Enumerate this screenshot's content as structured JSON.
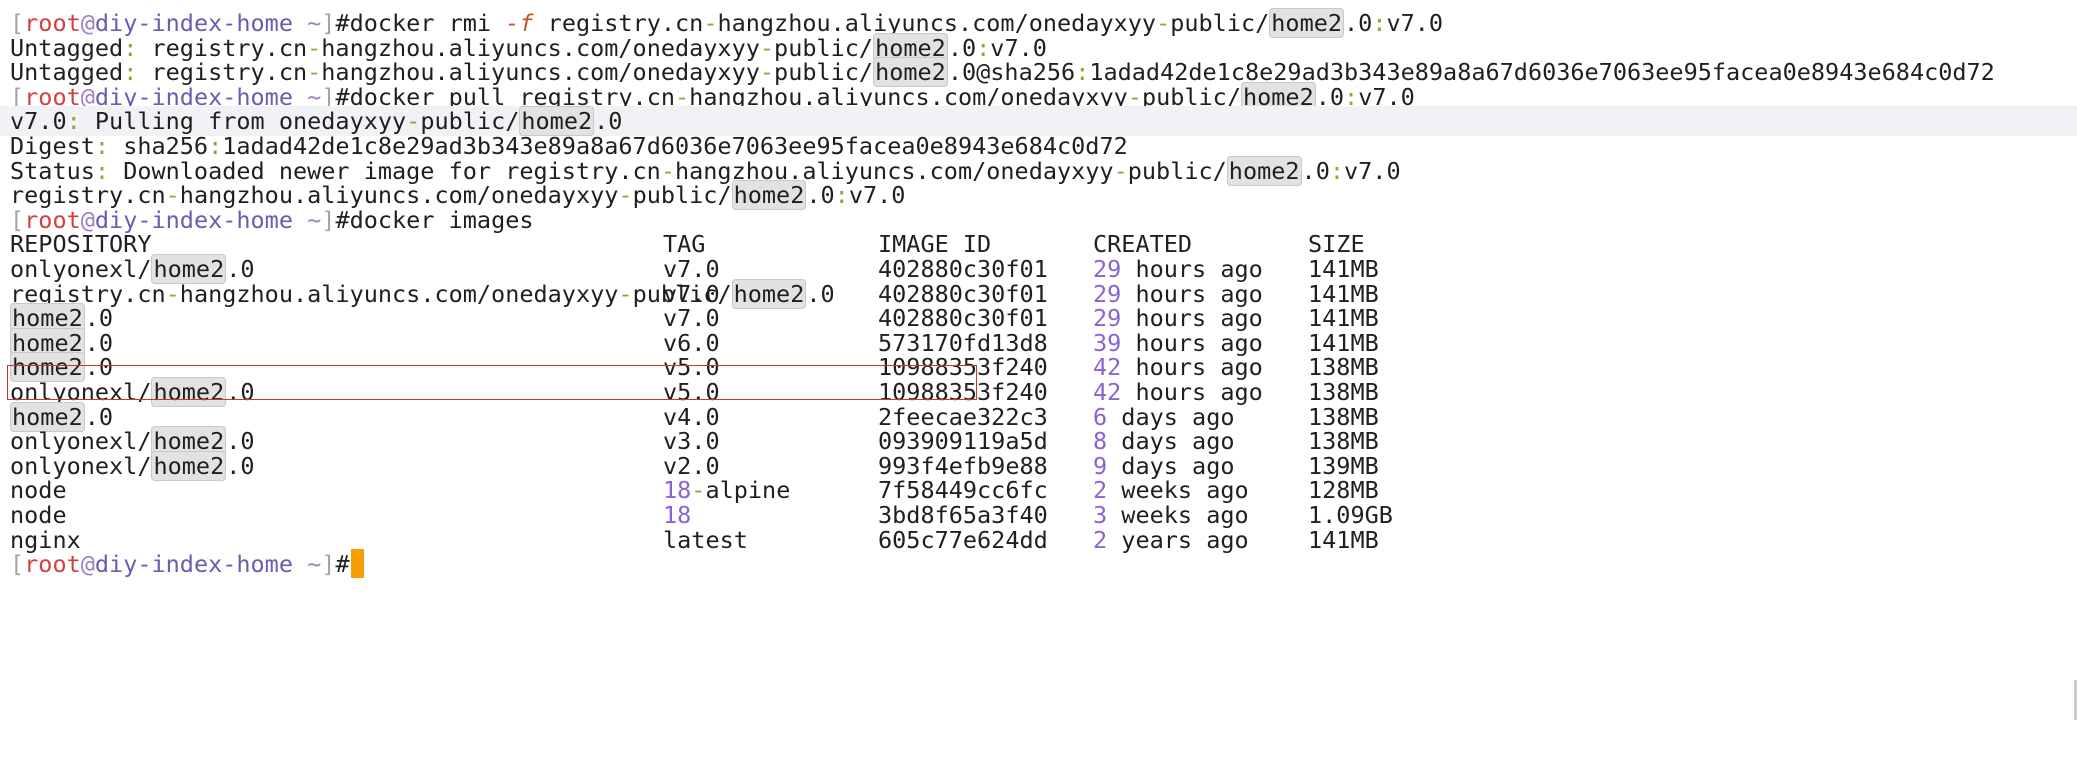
{
  "prompt": {
    "open": "[",
    "user": "root",
    "at": "@",
    "host": "diy-index-home",
    "tilde": " ~",
    "close": "]",
    "hash": "#"
  },
  "lines": [
    {
      "type": "cmd",
      "tokens": [
        {
          "t": "docker rmi "
        },
        {
          "t": "-f",
          "c": "flag"
        },
        {
          "t": " registry.cn"
        },
        {
          "t": "-",
          "c": "sep"
        },
        {
          "t": "hangzhou.aliyuncs.com/onedayxyy"
        },
        {
          "t": "-",
          "c": "sep"
        },
        {
          "t": "public/"
        },
        {
          "t": "home2",
          "c": "match"
        },
        {
          "t": ".0"
        },
        {
          "t": ":",
          "c": "sep"
        },
        {
          "t": "v7.0"
        }
      ]
    },
    {
      "type": "out",
      "tokens": [
        {
          "t": "Untagged"
        },
        {
          "t": ":",
          "c": "sep"
        },
        {
          "t": " registry.cn"
        },
        {
          "t": "-",
          "c": "sep"
        },
        {
          "t": "hangzhou.aliyuncs.com/onedayxyy"
        },
        {
          "t": "-",
          "c": "sep"
        },
        {
          "t": "public/"
        },
        {
          "t": "home2",
          "c": "match"
        },
        {
          "t": ".0"
        },
        {
          "t": ":",
          "c": "sep"
        },
        {
          "t": "v7.0"
        }
      ]
    },
    {
      "type": "out",
      "tokens": [
        {
          "t": "Untagged"
        },
        {
          "t": ":",
          "c": "sep"
        },
        {
          "t": " registry.cn"
        },
        {
          "t": "-",
          "c": "sep"
        },
        {
          "t": "hangzhou.aliyuncs.com/onedayxyy"
        },
        {
          "t": "-",
          "c": "sep"
        },
        {
          "t": "public/"
        },
        {
          "t": "home2",
          "c": "match"
        },
        {
          "t": ".0@sha256"
        },
        {
          "t": ":",
          "c": "sep"
        },
        {
          "t": "1adad42de1c8e29ad3b343e89a8a67d6036e7063ee95facea0e8943e684c0d72"
        }
      ]
    },
    {
      "type": "cmd",
      "tokens": [
        {
          "t": "docker pull registry.cn"
        },
        {
          "t": "-",
          "c": "sep"
        },
        {
          "t": "hangzhou.aliyuncs.com/onedayxyy"
        },
        {
          "t": "-",
          "c": "sep"
        },
        {
          "t": "public/"
        },
        {
          "t": "home2",
          "c": "match"
        },
        {
          "t": ".0"
        },
        {
          "t": ":",
          "c": "sep"
        },
        {
          "t": "v7.0"
        }
      ]
    },
    {
      "type": "out",
      "highlight": true,
      "tokens": [
        {
          "t": "v7.0"
        },
        {
          "t": ":",
          "c": "sep"
        },
        {
          "t": " Pulling from onedayxyy"
        },
        {
          "t": "-",
          "c": "sep"
        },
        {
          "t": "public/"
        },
        {
          "t": "home2",
          "c": "match"
        },
        {
          "t": ".0"
        }
      ]
    },
    {
      "type": "out",
      "tokens": [
        {
          "t": "Digest"
        },
        {
          "t": ":",
          "c": "sep"
        },
        {
          "t": " sha256"
        },
        {
          "t": ":",
          "c": "sep"
        },
        {
          "t": "1adad42de1c8e29ad3b343e89a8a67d6036e7063ee95facea0e8943e684c0d72"
        }
      ]
    },
    {
      "type": "out",
      "tokens": [
        {
          "t": "Status"
        },
        {
          "t": ":",
          "c": "sep"
        },
        {
          "t": " Downloaded newer image for registry.cn"
        },
        {
          "t": "-",
          "c": "sep"
        },
        {
          "t": "hangzhou.aliyuncs.com/onedayxyy"
        },
        {
          "t": "-",
          "c": "sep"
        },
        {
          "t": "public/"
        },
        {
          "t": "home2",
          "c": "match"
        },
        {
          "t": ".0"
        },
        {
          "t": ":",
          "c": "sep"
        },
        {
          "t": "v7.0"
        }
      ]
    },
    {
      "type": "out",
      "tokens": [
        {
          "t": "registry.cn"
        },
        {
          "t": "-",
          "c": "sep"
        },
        {
          "t": "hangzhou.aliyuncs.com/onedayxyy"
        },
        {
          "t": "-",
          "c": "sep"
        },
        {
          "t": "public/"
        },
        {
          "t": "home2",
          "c": "match"
        },
        {
          "t": ".0"
        },
        {
          "t": ":",
          "c": "sep"
        },
        {
          "t": "v7.0"
        }
      ]
    },
    {
      "type": "cmd",
      "tokens": [
        {
          "t": "docker images"
        }
      ]
    },
    {
      "type": "table",
      "cells": [
        [
          {
            "t": "REPOSITORY"
          }
        ],
        [
          {
            "t": "TAG"
          }
        ],
        [
          {
            "t": "IMAGE ID"
          }
        ],
        [
          {
            "t": "CREATED"
          }
        ],
        [
          {
            "t": "SIZE"
          }
        ]
      ]
    },
    {
      "type": "table",
      "cells": [
        [
          {
            "t": "onlyonexl/"
          },
          {
            "t": "home2",
            "c": "match"
          },
          {
            "t": ".0"
          }
        ],
        [
          {
            "t": "v7.0"
          }
        ],
        [
          {
            "t": "402880c30f01"
          }
        ],
        [
          {
            "t": "29",
            "c": "num"
          },
          {
            "t": " hours ago"
          }
        ],
        [
          {
            "t": "141MB"
          }
        ]
      ]
    },
    {
      "type": "table",
      "cells": [
        [
          {
            "t": "registry.cn"
          },
          {
            "t": "-",
            "c": "sep"
          },
          {
            "t": "hangzhou.aliyuncs.com/onedayxyy"
          },
          {
            "t": "-",
            "c": "sep"
          },
          {
            "t": "public/"
          },
          {
            "t": "home2",
            "c": "match"
          },
          {
            "t": ".0"
          }
        ],
        [
          {
            "t": "v7.0"
          }
        ],
        [
          {
            "t": "402880c30f01"
          }
        ],
        [
          {
            "t": "29",
            "c": "num"
          },
          {
            "t": " hours ago"
          }
        ],
        [
          {
            "t": "141MB"
          }
        ]
      ]
    },
    {
      "type": "table",
      "cells": [
        [
          {
            "t": "home2",
            "c": "match"
          },
          {
            "t": ".0"
          }
        ],
        [
          {
            "t": "v7.0"
          }
        ],
        [
          {
            "t": "402880c30f01"
          }
        ],
        [
          {
            "t": "29",
            "c": "num"
          },
          {
            "t": " hours ago"
          }
        ],
        [
          {
            "t": "141MB"
          }
        ]
      ]
    },
    {
      "type": "table",
      "cells": [
        [
          {
            "t": "home2",
            "c": "match"
          },
          {
            "t": ".0"
          }
        ],
        [
          {
            "t": "v6.0"
          }
        ],
        [
          {
            "t": "573170fd13d8"
          }
        ],
        [
          {
            "t": "39",
            "c": "num"
          },
          {
            "t": " hours ago"
          }
        ],
        [
          {
            "t": "141MB"
          }
        ]
      ]
    },
    {
      "type": "table",
      "cells": [
        [
          {
            "t": "home2",
            "c": "match"
          },
          {
            "t": ".0"
          }
        ],
        [
          {
            "t": "v5.0"
          }
        ],
        [
          {
            "t": "10988353f240"
          }
        ],
        [
          {
            "t": "42",
            "c": "num"
          },
          {
            "t": " hours ago"
          }
        ],
        [
          {
            "t": "138MB"
          }
        ]
      ]
    },
    {
      "type": "table",
      "cells": [
        [
          {
            "t": "onlyonexl/"
          },
          {
            "t": "home2",
            "c": "match"
          },
          {
            "t": ".0"
          }
        ],
        [
          {
            "t": "v5.0"
          }
        ],
        [
          {
            "t": "10988353f240"
          }
        ],
        [
          {
            "t": "42",
            "c": "num"
          },
          {
            "t": " hours ago"
          }
        ],
        [
          {
            "t": "138MB"
          }
        ]
      ]
    },
    {
      "type": "table",
      "cells": [
        [
          {
            "t": "home2",
            "c": "match"
          },
          {
            "t": ".0"
          }
        ],
        [
          {
            "t": "v4.0"
          }
        ],
        [
          {
            "t": "2feecae322c3"
          }
        ],
        [
          {
            "t": "6",
            "c": "num"
          },
          {
            "t": " days ago"
          }
        ],
        [
          {
            "t": "138MB"
          }
        ]
      ]
    },
    {
      "type": "table",
      "cells": [
        [
          {
            "t": "onlyonexl/"
          },
          {
            "t": "home2",
            "c": "match"
          },
          {
            "t": ".0"
          }
        ],
        [
          {
            "t": "v3.0"
          }
        ],
        [
          {
            "t": "093909119a5d"
          }
        ],
        [
          {
            "t": "8",
            "c": "num"
          },
          {
            "t": " days ago"
          }
        ],
        [
          {
            "t": "138MB"
          }
        ]
      ]
    },
    {
      "type": "table",
      "cells": [
        [
          {
            "t": "onlyonexl/"
          },
          {
            "t": "home2",
            "c": "match"
          },
          {
            "t": ".0"
          }
        ],
        [
          {
            "t": "v2.0"
          }
        ],
        [
          {
            "t": "993f4efb9e88"
          }
        ],
        [
          {
            "t": "9",
            "c": "num"
          },
          {
            "t": " days ago"
          }
        ],
        [
          {
            "t": "139MB"
          }
        ]
      ]
    },
    {
      "type": "table",
      "cells": [
        [
          {
            "t": "node"
          }
        ],
        [
          {
            "t": "18",
            "c": "num"
          },
          {
            "t": "-",
            "c": "sep"
          },
          {
            "t": "alpine"
          }
        ],
        [
          {
            "t": "7f58449cc6fc"
          }
        ],
        [
          {
            "t": "2",
            "c": "num"
          },
          {
            "t": " weeks ago"
          }
        ],
        [
          {
            "t": "128MB"
          }
        ]
      ]
    },
    {
      "type": "table",
      "cells": [
        [
          {
            "t": "node"
          }
        ],
        [
          {
            "t": "18",
            "c": "num"
          }
        ],
        [
          {
            "t": "3bd8f65a3f40"
          }
        ],
        [
          {
            "t": "3",
            "c": "num"
          },
          {
            "t": " weeks ago"
          }
        ],
        [
          {
            "t": "1.09GB"
          }
        ]
      ]
    },
    {
      "type": "table",
      "cells": [
        [
          {
            "t": "nginx"
          }
        ],
        [
          {
            "t": "latest"
          }
        ],
        [
          {
            "t": "605c77e624dd"
          }
        ],
        [
          {
            "t": "2",
            "c": "num"
          },
          {
            "t": " years ago"
          }
        ],
        [
          {
            "t": "141MB"
          }
        ]
      ]
    },
    {
      "type": "cmd",
      "cursor": true,
      "tokens": []
    }
  ],
  "colors": {
    "background": "#ffffff",
    "text": "#1f1f1f",
    "prompt_user": "#d24040",
    "prompt_host": "#6c5bb0",
    "separator": "#9aa33b",
    "number": "#8a63d2",
    "cursor": "#f5a000",
    "selection_box": "#c0393b",
    "highlight_line": "#f1f2f5"
  }
}
